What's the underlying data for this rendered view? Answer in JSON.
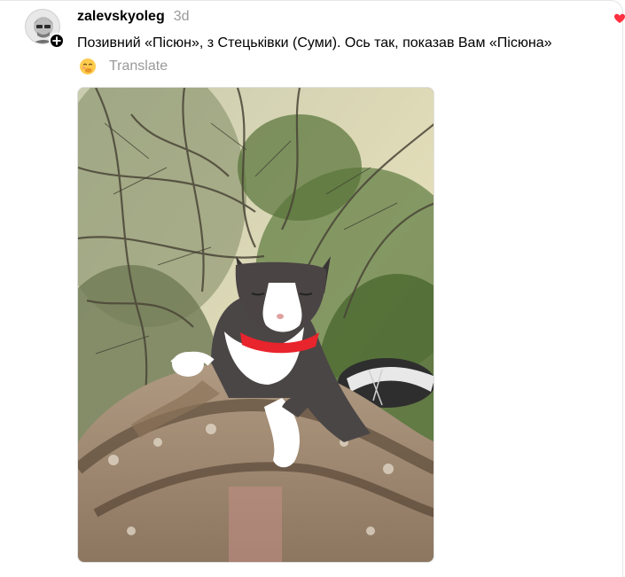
{
  "post": {
    "username": "zalevskyoleg",
    "timestamp": "3d",
    "caption": "Позивний «Пісюн», з Стецьківки (Суми). Ось так, показав Вам «Пісюна»",
    "translate_label": "Translate",
    "avatar_icon": "user-avatar",
    "follow_icon": "plus-icon",
    "translate_emoji": "face-with-hand-over-mouth-emoji",
    "reaction_icon": "heart-icon"
  },
  "colors": {
    "text": "#000000",
    "muted": "#999999",
    "heart": "#ff3040",
    "badge": "#000000"
  }
}
